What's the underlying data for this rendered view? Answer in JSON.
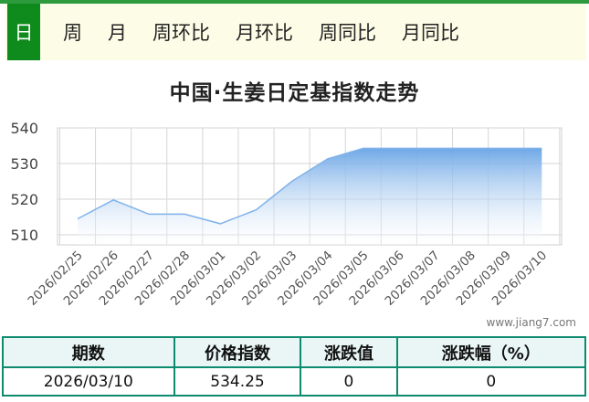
{
  "tabs": [
    {
      "label": "日",
      "active": true
    },
    {
      "label": "周",
      "active": false
    },
    {
      "label": "月",
      "active": false
    },
    {
      "label": "周环比",
      "active": false
    },
    {
      "label": "月环比",
      "active": false
    },
    {
      "label": "周同比",
      "active": false
    },
    {
      "label": "月同比",
      "active": false
    }
  ],
  "watermark": "www.jiang7.com",
  "table": {
    "headers": [
      "期数",
      "价格指数",
      "涨跌值",
      "涨跌幅（%）"
    ],
    "row": [
      "2026/03/10",
      "534.25",
      "0",
      "0"
    ]
  },
  "colors": {
    "brand_green": "#0f8a1c",
    "area_top": "#6fa8e6",
    "table_border": "#0e8a6e"
  },
  "chart_data": {
    "type": "area",
    "title": "中国·生姜日定基指数走势",
    "categories": [
      "2026/02/25",
      "2026/02/26",
      "2026/02/27",
      "2026/02/28",
      "2026/03/01",
      "2026/03/02",
      "2026/03/03",
      "2026/03/04",
      "2026/03/05",
      "2026/03/06",
      "2026/03/07",
      "2026/03/08",
      "2026/03/09",
      "2026/03/10"
    ],
    "values": [
      514.5,
      519.8,
      515.8,
      515.8,
      513.1,
      517.0,
      525.0,
      531.3,
      534.25,
      534.25,
      534.25,
      534.25,
      534.25,
      534.25
    ],
    "yticks": [
      "540",
      "530",
      "520",
      "510"
    ],
    "ylim": [
      510,
      540
    ],
    "grid": true
  }
}
